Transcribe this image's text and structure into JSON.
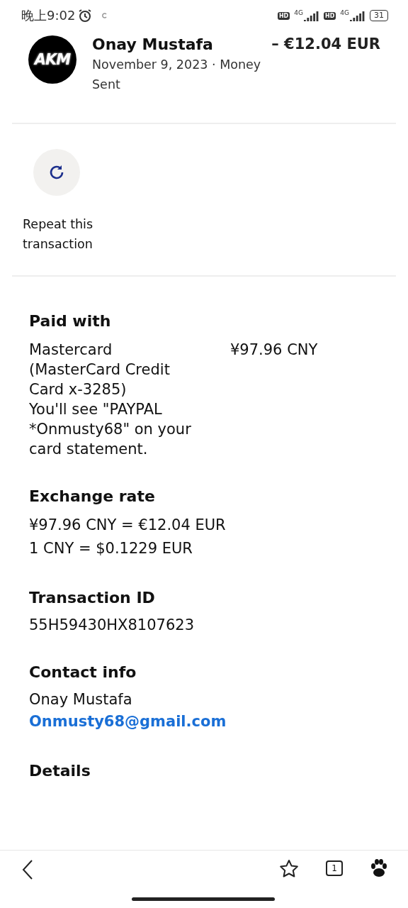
{
  "status_bar": {
    "time": "晚上9:02",
    "battery": "31",
    "hd_1": "HD",
    "network_1": "4G",
    "hd_2": "HD",
    "network_2": "4G"
  },
  "header": {
    "avatar_text": "AKM",
    "name": "Onay Mustafa",
    "amount": "– €12.04 EUR",
    "date": "November 9, 2023",
    "separator": "·",
    "type": "Money Sent"
  },
  "repeat": {
    "label": "Repeat this transaction"
  },
  "paid_with": {
    "title": "Paid with",
    "method": "Mastercard (MasterCard Credit Card x-3285)",
    "note": "You'll see \"PAYPAL *Onmusty68\" on your card statement.",
    "amount": "¥97.96 CNY"
  },
  "exchange_rate": {
    "title": "Exchange rate",
    "lines": [
      "¥97.96 CNY = €12.04 EUR",
      "1 CNY = $0.1229 EUR"
    ]
  },
  "transaction_id": {
    "title": "Transaction ID",
    "value": "55H59430HX8107623"
  },
  "contact_info": {
    "title": "Contact info",
    "name": "Onay Mustafa",
    "email": "Onmusty68@gmail.com"
  },
  "details": {
    "title": "Details"
  },
  "bottom_bar": {
    "tab_count": "1"
  }
}
